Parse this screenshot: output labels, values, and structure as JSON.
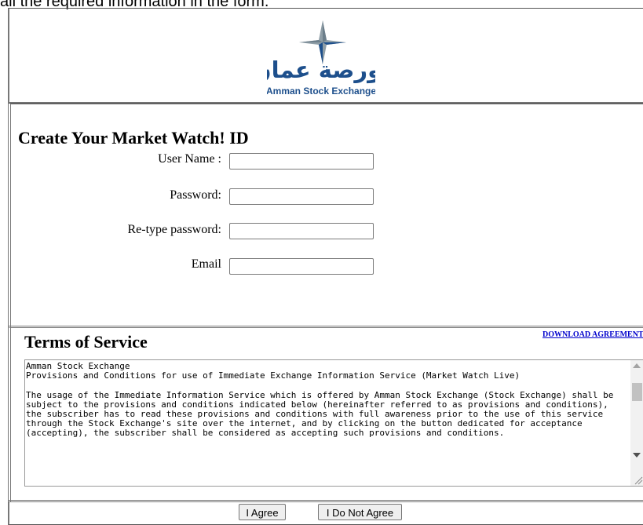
{
  "instruction": "all the required information in the form.",
  "logo": {
    "arabic_text": "بورصة عمان",
    "english_text": "Amman Stock Exchange",
    "colors": {
      "blue": "#1d4f8c",
      "gray": "#9aa6ad",
      "text": "#1d4f8c"
    }
  },
  "form": {
    "title": "Create Your Market Watch! ID",
    "username_label": "User Name :",
    "password_label": "Password:",
    "retype_label": "Re-type password:",
    "email_label": "Email",
    "username_value": "",
    "password_value": "",
    "retype_value": "",
    "email_value": ""
  },
  "terms": {
    "title": "Terms of Service",
    "download_link": "DOWNLOAD AGREEMENT",
    "text": "Amman Stock Exchange\nProvisions and Conditions for use of Immediate Exchange Information Service (Market Watch Live)\n\nThe usage of the Immediate Information Service which is offered by Amman Stock Exchange (Stock Exchange) shall be subject to the provisions and conditions indicated below (hereinafter referred to as provisions and conditions), the subscriber has to read these provisions and conditions with full awareness prior to the use of this service through the Stock Exchange's site over the internet, and by clicking on the button dedicated for acceptance (accepting), the subscriber shall be considered as accepting such provisions and conditions."
  },
  "buttons": {
    "agree": "I Agree",
    "disagree": "I Do Not Agree"
  }
}
